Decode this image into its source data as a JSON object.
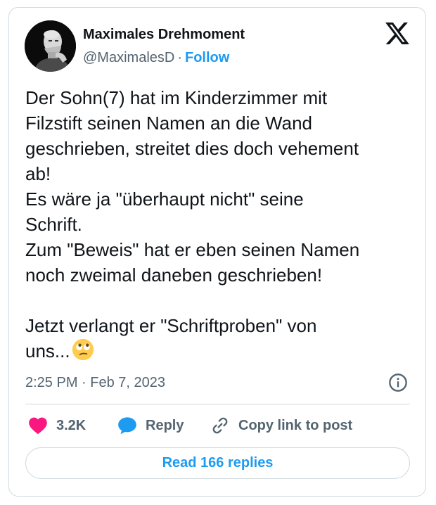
{
  "author": {
    "display_name": "Maximales Drehmoment",
    "handle": "@MaximalesD",
    "separator": "·",
    "follow_label": "Follow"
  },
  "brand_icon": "x-logo-icon",
  "tweet": {
    "text": "Der Sohn(7) hat im Kinderzimmer mit\nFilzstift seinen Namen an die Wand\ngeschrieben, streitet dies doch vehement\nab!\nEs wäre ja \"überhaupt nicht\" seine\nSchrift.\nZum \"Beweis\" hat er eben seinen Namen\nnoch zweimal daneben geschrieben!\n\nJetzt verlangt er \"Schriftproben\" von\nuns...",
    "emoji": "face-with-rolling-eyes",
    "timestamp": "2:25 PM · Feb 7, 2023"
  },
  "actions": {
    "likes": "3.2K",
    "reply_label": "Reply",
    "copy_label": "Copy link to post"
  },
  "read_replies_label": "Read 166 replies",
  "colors": {
    "accent": "#1d9bf0",
    "like": "#f91880",
    "secondary_text": "#536471",
    "border": "#cfd9de"
  }
}
